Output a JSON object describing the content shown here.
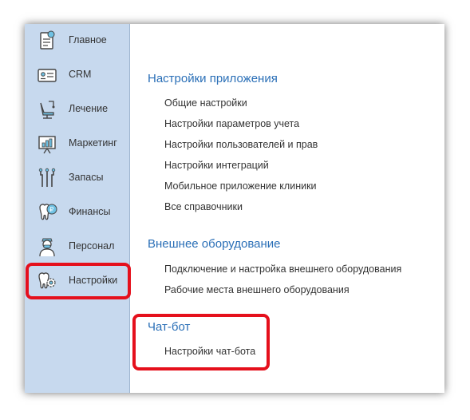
{
  "sidebar": {
    "items": [
      {
        "label": "Главное",
        "icon": "home-document-icon"
      },
      {
        "label": "CRM",
        "icon": "id-card-icon"
      },
      {
        "label": "Лечение",
        "icon": "dental-chair-icon"
      },
      {
        "label": "Маркетинг",
        "icon": "presentation-chart-icon"
      },
      {
        "label": "Запасы",
        "icon": "dental-tools-icon"
      },
      {
        "label": "Финансы",
        "icon": "tooth-ruble-icon"
      },
      {
        "label": "Персонал",
        "icon": "doctor-icon"
      },
      {
        "label": "Настройки",
        "icon": "tooth-gear-icon"
      }
    ],
    "selected": "Настройки"
  },
  "content": {
    "sections": [
      {
        "title": "Настройки приложения",
        "links": [
          "Общие настройки",
          "Настройки параметров учета",
          "Настройки пользователей и прав",
          "Настройки интеграций",
          "Мобильное приложение клиники",
          "Все справочники"
        ]
      },
      {
        "title": "Внешнее оборудование",
        "links": [
          "Подключение и настройка внешнего оборудования",
          "Рабочие места внешнего оборудования"
        ]
      },
      {
        "title": "Чат-бот",
        "links": [
          "Настройки чат-бота"
        ]
      }
    ]
  },
  "colors": {
    "sidebar_bg": "#c7d9ee",
    "section_title": "#2a6fb7",
    "highlight": "#e5101c"
  }
}
